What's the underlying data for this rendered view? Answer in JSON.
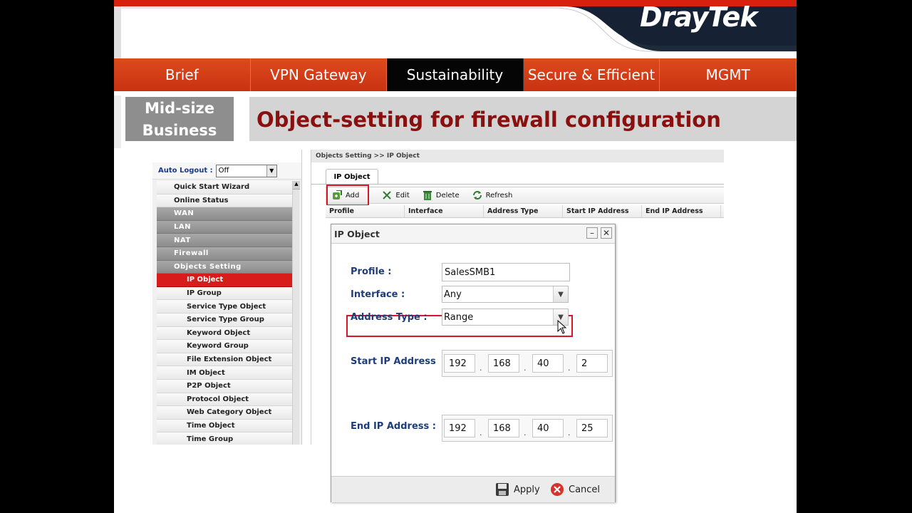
{
  "brand": {
    "logo_text": "DrayTek",
    "accent": "#d8200f",
    "nav_active_bg": "#050505",
    "title_color": "#8a1010"
  },
  "nav": {
    "tabs": [
      "Brief",
      "VPN Gateway",
      "Sustainability",
      "Secure & Efficient",
      "MGMT"
    ],
    "active": "Sustainability"
  },
  "slide": {
    "segment_line1": "Mid-size",
    "segment_line2": "Business",
    "title": "Object-setting for firewall configuration"
  },
  "menu": {
    "logout_label": "Auto Logout :",
    "logout_value": "Off",
    "items": [
      {
        "label": "Quick Start Wizard",
        "kind": "l1"
      },
      {
        "label": "Online Status",
        "kind": "l1"
      },
      {
        "label": "WAN",
        "kind": "grp"
      },
      {
        "label": "LAN",
        "kind": "grp"
      },
      {
        "label": "NAT",
        "kind": "grp"
      },
      {
        "label": "Firewall",
        "kind": "grp"
      },
      {
        "label": "Objects Setting",
        "kind": "grp"
      },
      {
        "label": "IP Object",
        "kind": "sel"
      },
      {
        "label": "IP Group",
        "kind": "sub"
      },
      {
        "label": "Service Type Object",
        "kind": "sub"
      },
      {
        "label": "Service Type Group",
        "kind": "sub"
      },
      {
        "label": "Keyword Object",
        "kind": "sub"
      },
      {
        "label": "Keyword Group",
        "kind": "sub"
      },
      {
        "label": "File Extension Object",
        "kind": "sub"
      },
      {
        "label": "IM Object",
        "kind": "sub"
      },
      {
        "label": "P2P Object",
        "kind": "sub"
      },
      {
        "label": "Protocol Object",
        "kind": "sub"
      },
      {
        "label": "Web Category Object",
        "kind": "sub"
      },
      {
        "label": "Time Object",
        "kind": "sub"
      },
      {
        "label": "Time Group",
        "kind": "sub"
      }
    ]
  },
  "content": {
    "breadcrumb": "Objects Setting >> IP Object",
    "tab": "IP Object",
    "toolbar": {
      "add": "Add",
      "edit": "Edit",
      "delete": "Delete",
      "refresh": "Refresh"
    },
    "columns": [
      "Profile",
      "Interface",
      "Address Type",
      "Start IP Address",
      "End IP Address"
    ]
  },
  "dialog": {
    "title": "IP Object",
    "profile_label": "Profile :",
    "profile_value": "SalesSMB1",
    "interface_label": "Interface :",
    "interface_value": "Any",
    "address_type_label": "Address Type :",
    "address_type_value": "Range",
    "start_label": "Start IP Address",
    "start_ip": [
      "192",
      "168",
      "40",
      "2"
    ],
    "end_label": "End IP Address :",
    "end_ip": [
      "192",
      "168",
      "40",
      "25"
    ],
    "apply": "Apply",
    "cancel": "Cancel"
  }
}
